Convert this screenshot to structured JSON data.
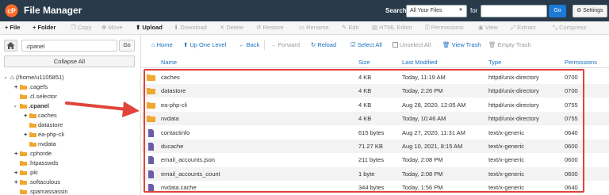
{
  "header": {
    "app_title": "File Manager",
    "search_label": "Search",
    "search_scope": "All Your Files",
    "for_label": "for",
    "search_value": "",
    "go_label": "Go",
    "settings_label": "Settings",
    "bg_color": "#293a4a",
    "accent_color": "#1b7ad6"
  },
  "toolbar": {
    "items": [
      {
        "label": "File",
        "icon": "plus-icon",
        "enabled": true
      },
      {
        "label": "Folder",
        "icon": "plus-icon",
        "enabled": true
      },
      {
        "label": "Copy",
        "icon": "copy-icon",
        "enabled": false
      },
      {
        "label": "Move",
        "icon": "move-icon",
        "enabled": false
      },
      {
        "label": "Upload",
        "icon": "upload-icon",
        "enabled": true
      },
      {
        "label": "Download",
        "icon": "download-icon",
        "enabled": false
      },
      {
        "label": "Delete",
        "icon": "close-icon",
        "enabled": false
      },
      {
        "label": "Restore",
        "icon": "restore-icon",
        "enabled": false
      },
      {
        "label": "Rename",
        "icon": "rename-icon",
        "enabled": false
      },
      {
        "label": "Edit",
        "icon": "pencil-icon",
        "enabled": false
      },
      {
        "label": "HTML Editor",
        "icon": "html-editor-icon",
        "enabled": false
      },
      {
        "label": "Permissions",
        "icon": "key-icon",
        "enabled": false
      },
      {
        "label": "View",
        "icon": "eye-icon",
        "enabled": false
      },
      {
        "label": "Extract",
        "icon": "extract-icon",
        "enabled": false
      },
      {
        "label": "Compress",
        "icon": "compress-icon",
        "enabled": false
      }
    ]
  },
  "left_panel": {
    "path_value": ".cpanel",
    "go_label": "Go",
    "collapse_label": "Collapse All",
    "tree": [
      {
        "label": "(/home/u1105851)",
        "toggle": "-",
        "root": true
      },
      {
        "label": ".cagefs",
        "toggle": "+"
      },
      {
        "label": ".cl.selector",
        "toggle": ""
      },
      {
        "label": ".cpanel",
        "toggle": "-",
        "bold": true
      },
      {
        "label": "caches",
        "toggle": "+"
      },
      {
        "label": "datastore",
        "toggle": ""
      },
      {
        "label": "ea-php-cli",
        "toggle": "+"
      },
      {
        "label": "nvdata",
        "toggle": ""
      },
      {
        "label": ".cphorde",
        "toggle": "+"
      },
      {
        "label": ".htpasswds",
        "toggle": ""
      },
      {
        "label": ".pki",
        "toggle": "+"
      },
      {
        "label": ".softaculous",
        "toggle": "+"
      },
      {
        "label": ".spamassassin",
        "toggle": ""
      }
    ]
  },
  "nav": {
    "home": "Home",
    "up_one_level": "Up One Level",
    "back": "Back",
    "forward": "Forward",
    "reload": "Reload",
    "select_all": "Select All",
    "unselect_all": "Unselect All",
    "view_trash": "View Trash",
    "empty_trash": "Empty Trash"
  },
  "table": {
    "columns": [
      "Name",
      "Size",
      "Last Modified",
      "Type",
      "Permissions"
    ],
    "rows": [
      {
        "name": "caches",
        "size": "4 KB",
        "modified": "Today, 11:19 AM",
        "type": "httpd/unix-directory",
        "perms": "0700",
        "kind": "folder"
      },
      {
        "name": "datastore",
        "size": "4 KB",
        "modified": "Today, 2:26 PM",
        "type": "httpd/unix-directory",
        "perms": "0700",
        "kind": "folder"
      },
      {
        "name": "ea-php-cli",
        "size": "4 KB",
        "modified": "Aug 28, 2020, 12:05 AM",
        "type": "httpd/unix-directory",
        "perms": "0755",
        "kind": "folder"
      },
      {
        "name": "nvdata",
        "size": "4 KB",
        "modified": "Today, 10:46 AM",
        "type": "httpd/unix-directory",
        "perms": "0755",
        "kind": "folder"
      },
      {
        "name": "contactinfo",
        "size": "615 bytes",
        "modified": "Aug 27, 2020, 11:31 AM",
        "type": "text/x-generic",
        "perms": "0640",
        "kind": "file"
      },
      {
        "name": "ducache",
        "size": "71.27 KB",
        "modified": "Aug 10, 2021, 8:15 AM",
        "type": "text/x-generic",
        "perms": "0600",
        "kind": "file"
      },
      {
        "name": "email_accounts.json",
        "size": "211 bytes",
        "modified": "Today, 2:08 PM",
        "type": "text/x-generic",
        "perms": "0600",
        "kind": "file"
      },
      {
        "name": "email_accounts_count",
        "size": "1 byte",
        "modified": "Today, 2:08 PM",
        "type": "text/x-generic",
        "perms": "0600",
        "kind": "file"
      },
      {
        "name": "nvdata.cache",
        "size": "344 bytes",
        "modified": "Today, 1:56 PM",
        "type": "text/x-generic",
        "perms": "0640",
        "kind": "file"
      }
    ]
  },
  "colors": {
    "link": "#1a6fbf",
    "folder": "#f0a830",
    "file": "#6b5ca5",
    "highlight": "#e0443a"
  }
}
